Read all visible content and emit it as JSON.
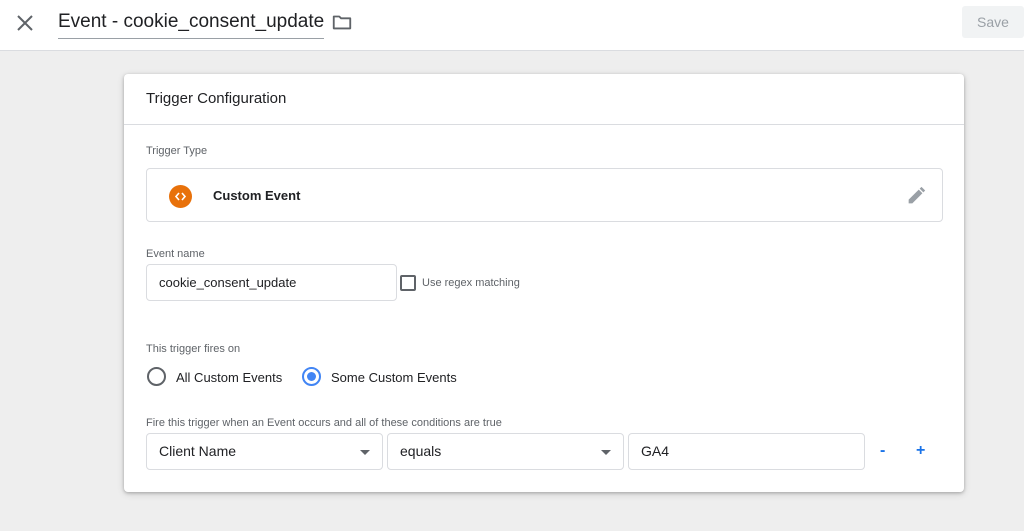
{
  "header": {
    "title": "Event - cookie_consent_update",
    "save_label": "Save"
  },
  "card": {
    "title": "Trigger Configuration",
    "trigger_type": {
      "label": "Trigger Type",
      "name": "Custom Event",
      "icon": "code-brackets-icon",
      "icon_color": "#e8710a"
    },
    "event_name": {
      "label": "Event name",
      "value": "cookie_consent_update",
      "regex_label": "Use regex matching",
      "regex_checked": false
    },
    "fires_on": {
      "label": "This trigger fires on",
      "options": [
        "All Custom Events",
        "Some Custom Events"
      ],
      "selected": "Some Custom Events"
    },
    "condition": {
      "label": "Fire this trigger when an Event occurs and all of these conditions are true",
      "variable": "Client Name",
      "operator": "equals",
      "value": "GA4",
      "remove_label": "-",
      "add_label": "+"
    }
  },
  "colors": {
    "accent": "#1a73e8",
    "radio_selected": "#4285f4",
    "background": "#eeeeee"
  }
}
